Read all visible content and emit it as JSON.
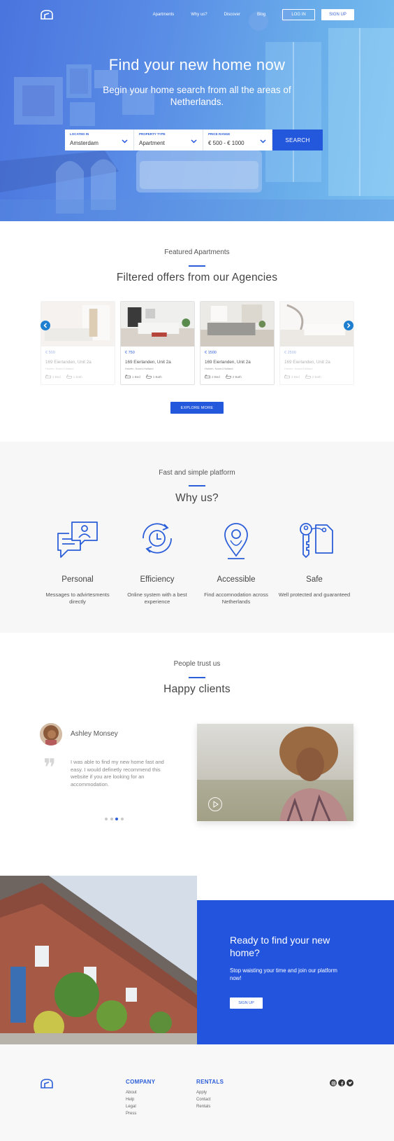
{
  "nav": {
    "links": [
      "Apartments",
      "Why us?",
      "Discover",
      "Blog"
    ],
    "login": "LOG IN",
    "signup": "SIGN UP"
  },
  "hero": {
    "title": "Find your new home now",
    "subtitle": "Begin your home search from all the areas of Netherlands.",
    "search": {
      "location_label": "LOCATED IN",
      "location_value": "Amsterdam",
      "type_label": "PROPERTY TYPE",
      "type_value": "Apartment",
      "price_label": "PRICE RANGE",
      "price_value": "€ 500 - € 1000",
      "button": "SEARCH"
    }
  },
  "featured": {
    "subtitle": "Featured Apartments",
    "title": "Filtered offers from our Agencies",
    "cards": [
      {
        "price": "€ 500",
        "address": "169 Eierlanden, Unit 2a",
        "city": "Hoizen, Noord-Holland",
        "bed": "1 Bed",
        "bath": "1 Bath"
      },
      {
        "price": "€ 750",
        "address": "169 Eierlanden, Unit 2a",
        "city": "Hoizen, Noord-Holland",
        "bed": "1 Bed",
        "bath": "1 Bath"
      },
      {
        "price": "€ 1500",
        "address": "169 Eierlanden, Unit 2a",
        "city": "Hoizen, Noord-Holland",
        "bed": "2 Bed",
        "bath": "2 Bath"
      },
      {
        "price": "€ 2500",
        "address": "169 Eierlanden, Unit 2a",
        "city": "Hoizen, Noord-Holland",
        "bed": "3 Bed",
        "bath": "2 Bath"
      }
    ],
    "explore": "EXPLORE MORE"
  },
  "why": {
    "subtitle": "Fast and simple platform",
    "title": "Why us?",
    "features": [
      {
        "title": "Personal",
        "desc": "Messages to advirtesments directly"
      },
      {
        "title": "Efficiency",
        "desc": "Online system with a best experience"
      },
      {
        "title": "Accessible",
        "desc": "Find accomnodation across Netherlands"
      },
      {
        "title": "Safe",
        "desc": "Well protected and guaranteed"
      }
    ]
  },
  "clients": {
    "subtitle": "People trust us",
    "title": "Happy clients",
    "name": "Ashley Monsey",
    "quote": "I was able to find my new home fast and easy. I would definetly recommend this website if you are looking for an accommodation.",
    "active_dot": 3,
    "dot_count": 4
  },
  "cta": {
    "title": "Ready to find your new home?",
    "text": "Stop waisting your time and join our platform now!",
    "button": "SIGN UP"
  },
  "footer": {
    "company_title": "COMPANY",
    "company_links": [
      "About",
      "Help",
      "Legal",
      "Press"
    ],
    "rentals_title": "RENTALS",
    "rentals_links": [
      "Apply",
      "Contact",
      "Rentals"
    ],
    "social": [
      "instagram-icon",
      "facebook-icon",
      "twitter-icon"
    ]
  },
  "colors": {
    "accent": "#2458dc",
    "hero_start": "#4a74de",
    "hero_end": "#79c0f0",
    "arrow": "#1e7fd0"
  }
}
